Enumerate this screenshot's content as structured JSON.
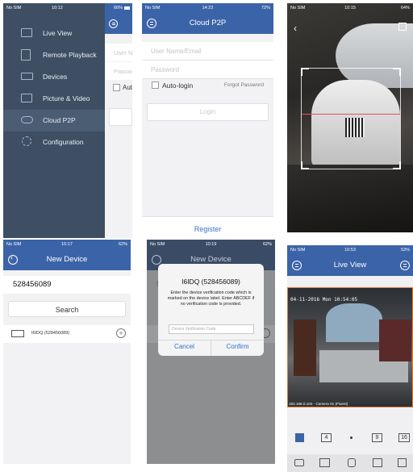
{
  "p1": {
    "status": {
      "carrier": "No SIM",
      "time": "10:12",
      "battery": "66%"
    },
    "menu": [
      {
        "label": "Live View",
        "icon": "live-view-icon"
      },
      {
        "label": "Remote Playback",
        "icon": "remote-playback-icon"
      },
      {
        "label": "Devices",
        "icon": "devices-icon"
      },
      {
        "label": "Picture & Video",
        "icon": "picture-video-icon"
      },
      {
        "label": "Cloud P2P",
        "icon": "cloud-icon"
      },
      {
        "label": "Configuration",
        "icon": "gear-icon"
      }
    ],
    "peek": {
      "user": "User Na",
      "pass": "Passwo",
      "auto": "Auto"
    }
  },
  "p2": {
    "status": {
      "carrier": "No SIM",
      "time": "14:22",
      "battery": "72%"
    },
    "title": "Cloud P2P",
    "username_placeholder": "User Name/Email",
    "password_placeholder": "Password",
    "autologin": "Auto-login",
    "forgot": "Forgot Password",
    "login": "Login",
    "register": "Register"
  },
  "p3": {
    "status": {
      "carrier": "No SIM",
      "time": "10:15",
      "battery": "64%"
    }
  },
  "p4": {
    "status": {
      "carrier": "No SIM",
      "time": "10:17",
      "battery": "62%"
    },
    "title": "New Device",
    "serial": "528456089",
    "search": "Search",
    "result": "I6IDQ (528456089)"
  },
  "p5": {
    "status": {
      "carrier": "No SIM",
      "time": "10:19",
      "battery": "62%"
    },
    "title": "New Device",
    "bg_serial": "528456089",
    "dialog_title": "I6IDQ (528456089)",
    "dialog_msg": "Enter the device verification code which is marked on the device label. Enter ABCDEF if no verification code is provided.",
    "input_placeholder": "Device Verification Code",
    "cancel": "Cancel",
    "confirm": "Confirm"
  },
  "p6": {
    "status": {
      "carrier": "No SIM",
      "time": "10:53",
      "battery": "53%"
    },
    "title": "Live View",
    "osd_time": "04-11-2016 Mon 10:54:05",
    "camera_label": "192.168.0.104 - Camera 01 (Fluent)",
    "layout": [
      "4",
      "9",
      "16"
    ]
  }
}
